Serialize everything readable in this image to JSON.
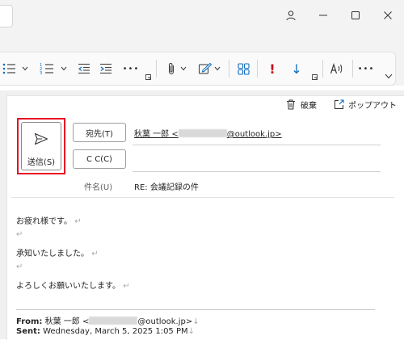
{
  "compose": {
    "send_label": "送信(S)",
    "to_button_label": "宛先(T)",
    "cc_button_label": "C C(C)",
    "to_name": "秋葉 一郎 <",
    "to_email_suffix": "@outlook.jp>",
    "subject_label": "件名(U)",
    "subject_value": "RE: 会議記録の件",
    "discard_label": "破棄",
    "popout_label": "ポップアウト"
  },
  "body": {
    "line1": "お疲れ様です。",
    "line2": "承知いたしました。",
    "line3": "よろしくお願いいたします。",
    "return_mark": "↵"
  },
  "quoted": {
    "from_label": "From:",
    "from_name": "秋葉 一郎 <",
    "from_email_suffix": "@outlook.jp>",
    "sent_label": "Sent:",
    "sent_value": "Wednesday, March 5, 2025 1:05 PM",
    "line_break_mark": "↓"
  },
  "ribbon": {
    "more_label": "•••",
    "important_mark": "!",
    "low_importance_mark": "↓"
  },
  "colors": {
    "accent": "#0f6cbd",
    "important": "#c50f1f",
    "highlight_outline": "#e81123"
  }
}
